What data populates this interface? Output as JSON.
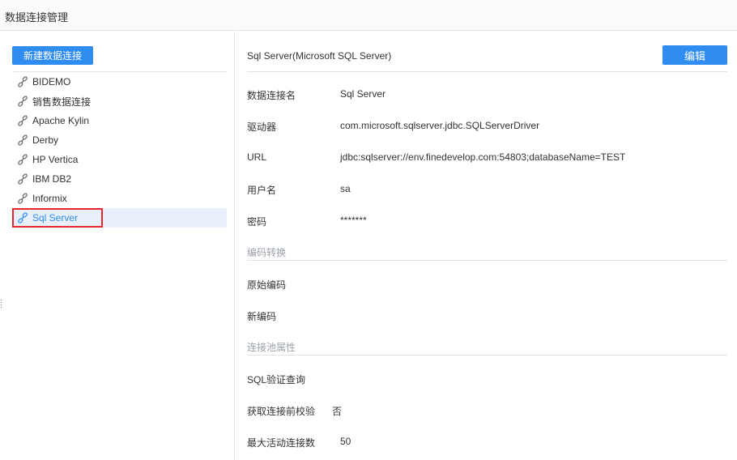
{
  "window": {
    "title": "数据连接管理"
  },
  "left": {
    "new_button": "新建数据连接",
    "connections": [
      {
        "label": "BIDEMO"
      },
      {
        "label": "销售数据连接"
      },
      {
        "label": "Apache Kylin"
      },
      {
        "label": "Derby"
      },
      {
        "label": "HP Vertica"
      },
      {
        "label": "IBM DB2"
      },
      {
        "label": "Informix"
      },
      {
        "label": "Sql Server",
        "selected": true
      }
    ]
  },
  "detail": {
    "header": "Sql Server(Microsoft SQL Server)",
    "edit_button": "编辑",
    "fields": [
      {
        "label": "数据连接名",
        "value": "Sql Server"
      },
      {
        "label": "驱动器",
        "value": "com.microsoft.sqlserver.jdbc.SQLServerDriver"
      },
      {
        "label": "URL",
        "value": "jdbc:sqlserver://env.finedevelop.com:54803;databaseName=TEST"
      },
      {
        "label": "用户名",
        "value": "sa"
      },
      {
        "label": "密码",
        "value": "*******"
      }
    ],
    "encoding_section": "编码转换",
    "encoding_fields": [
      {
        "label": "原始编码",
        "value": ""
      },
      {
        "label": "新编码",
        "value": ""
      }
    ],
    "pool_section": "连接池属性",
    "pool_fields": [
      {
        "label": "SQL验证查询",
        "value": ""
      },
      {
        "label": "获取连接前校验",
        "value": "否"
      },
      {
        "label": "最大活动连接数",
        "value": "50"
      }
    ]
  },
  "colors": {
    "accent": "#2f8cf0",
    "highlight_border": "#e8262e",
    "selected_bg": "#e8f0fc"
  }
}
